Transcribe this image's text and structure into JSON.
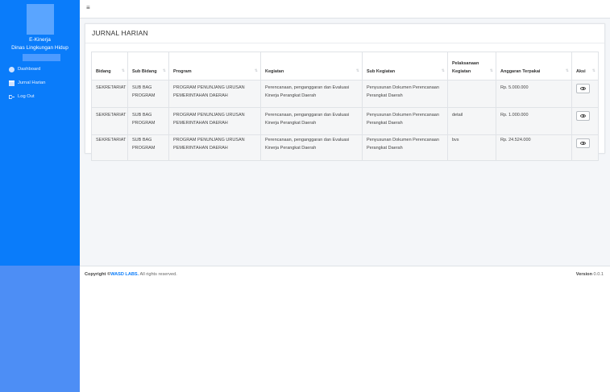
{
  "sidebar": {
    "brand_line1": "E-Kinerja",
    "brand_line2": "Dinas Lingkungan Hidup",
    "items": [
      {
        "label": "Dashboard",
        "icon": "dashboard-icon"
      },
      {
        "label": "Jurnal Harian",
        "icon": "calendar-icon"
      },
      {
        "label": "Log Out",
        "icon": "logout-icon"
      }
    ]
  },
  "header": {
    "menu_icon": "≡"
  },
  "page": {
    "title": "JURNAL HARIAN",
    "table": {
      "sort_icon": "⇅",
      "columns": [
        "Bidang",
        "Sub Bidang",
        "Program",
        "Kegiatan",
        "Sub Kegiatan",
        "Pelaksanaan Kegiatan",
        "Anggaran Terpakai",
        "Aksi"
      ],
      "rows": [
        {
          "bidang": "SEKRETARIAT",
          "sub_bidang": "SUB BAG PROGRAM",
          "program": "PROGRAM PENUNJANG URUSAN PEMERINTAHAN DAERAH",
          "kegiatan": "Perencanaan, penganggaran dan Evaluasi Kinerja Perangkat Daerah",
          "sub_kegiatan": "Penyusunan Dokumen Perencanaan Perangkat Daerah",
          "pelaksanaan": "",
          "anggaran": "Rp. 5.000.000"
        },
        {
          "bidang": "SEKRETARIAT",
          "sub_bidang": "SUB BAG PROGRAM",
          "program": "PROGRAM PENUNJANG URUSAN PEMERINTAHAN DAERAH",
          "kegiatan": "Perencanaan, penganggaran dan Evaluasi Kinerja Perangkat Daerah",
          "sub_kegiatan": "Penyusunan Dokumen Perencanaan Perangkat Daerah",
          "pelaksanaan": "detail",
          "anggaran": "Rp. 1.000.000"
        },
        {
          "bidang": "SEKRETARIAT",
          "sub_bidang": "SUB BAG PROGRAM",
          "program": "PROGRAM PENUNJANG URUSAN PEMERINTAHAN DAERAH",
          "kegiatan": "Perencanaan, penganggaran dan Evaluasi Kinerja Perangkat Daerah",
          "sub_kegiatan": "Penyusunan Dokumen Perencanaan Perangkat Daerah",
          "pelaksanaan": "bvs",
          "anggaran": "Rp. 24.524.000"
        }
      ]
    }
  },
  "footer": {
    "copyright_prefix": "Copyright ©",
    "brand": "WASD LABS.",
    "rights": " All rights reserved.",
    "version_label": "Version",
    "version_value": " 0.0.1"
  }
}
